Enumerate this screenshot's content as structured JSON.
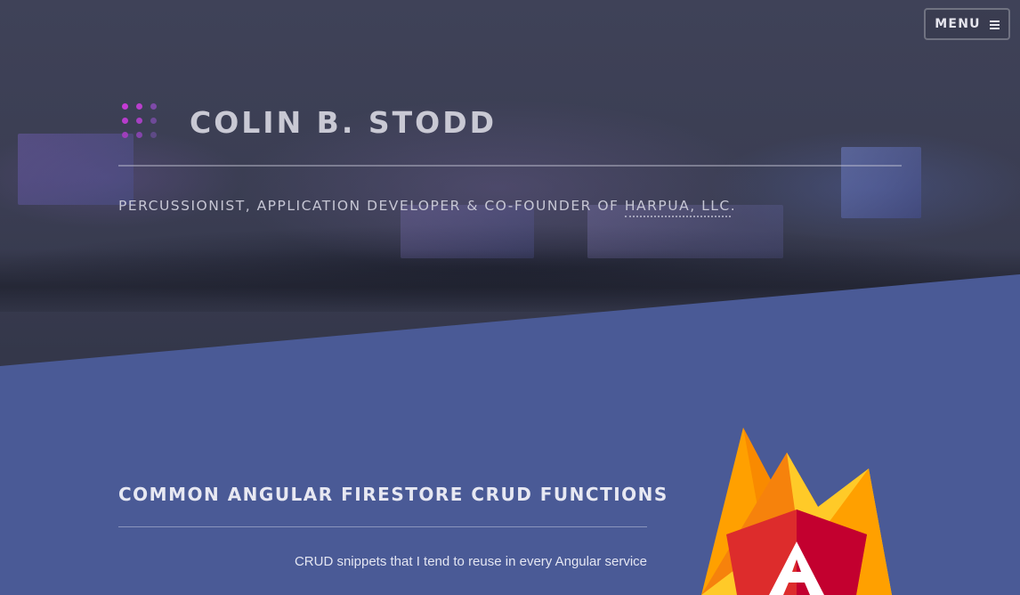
{
  "header": {
    "menu_label": "MENU",
    "site_title": "COLIN B. STODD",
    "tagline_prefix": "PERCUSSIONIST, APPLICATION DEVELOPER & CO-FOUNDER OF ",
    "tagline_link": "HARPUA, LLC",
    "tagline_suffix": "."
  },
  "post": {
    "title": "COMMON ANGULAR FIRESTORE CRUD FUNCTIONS",
    "description": "CRUD snippets that I tend to reuse in every Angular service"
  },
  "icons": {
    "menu": "hamburger-icon",
    "logo": "dot-grid-logo",
    "post_image": "firebase-angular-logo"
  },
  "colors": {
    "hero_bg": "#3a3d52",
    "content_bg": "#4a5a96",
    "accent_magenta": "#c13dd6",
    "title_text": "#c9c9d4"
  }
}
